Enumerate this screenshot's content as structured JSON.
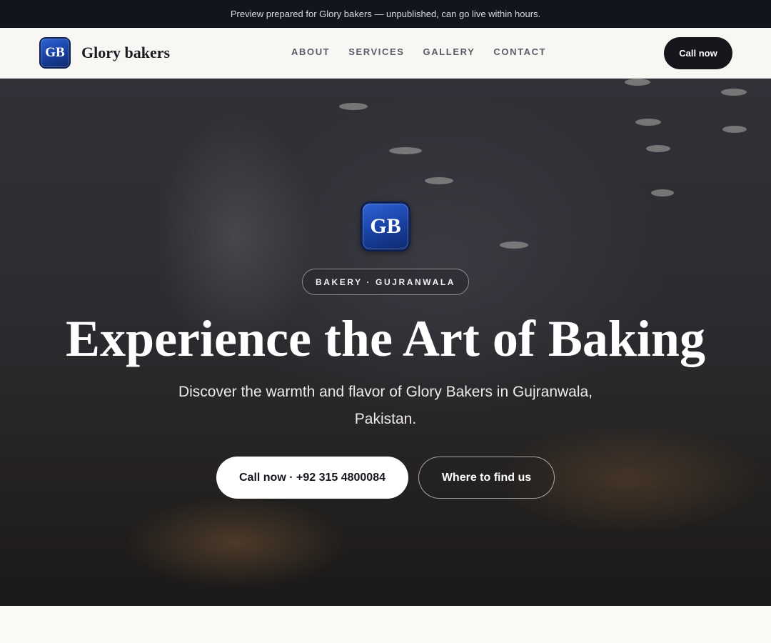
{
  "preview_bar": {
    "text": "Preview prepared for Glory bakers — unpublished, can go live within hours."
  },
  "nav": {
    "logo_initials": "GB",
    "brand_name": "Glory bakers",
    "links": [
      "ABOUT",
      "SERVICES",
      "GALLERY",
      "CONTACT"
    ],
    "call_label": "Call now"
  },
  "hero": {
    "logo_initials": "GB",
    "badge": "BAKERY · GUJRANWALA",
    "title": "Experience the Art of Baking",
    "subtitle": "Discover the warmth and flavor of Glory Bakers in Gujranwala, Pakistan.",
    "primary_cta": "Call now · +92 315 4800084",
    "secondary_cta": "Where to find us"
  },
  "colors": {
    "preview_bar_bg": "#12151c",
    "logo_blue": "#173f9e",
    "dark_button": "#14161c",
    "page_bg": "#faf9f6"
  }
}
